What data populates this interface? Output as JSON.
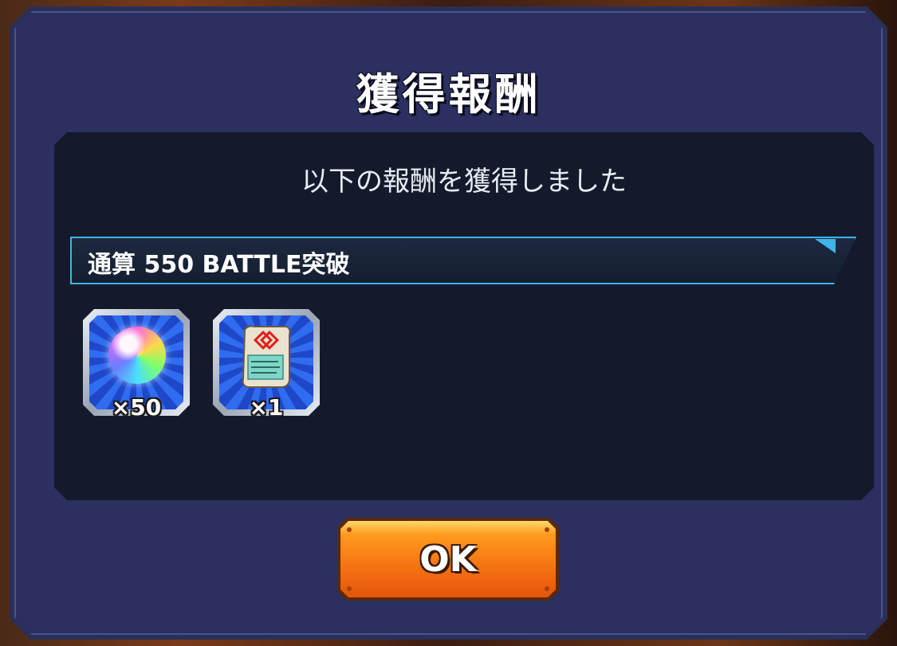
{
  "dialog": {
    "title": "獲得報酬",
    "message": "以下の報酬を獲得しました",
    "mission": "通算 550 BATTLE突破",
    "rewards": [
      {
        "icon": "rainbow-orb-icon",
        "quantity": "×50"
      },
      {
        "icon": "scroll-ticket-icon",
        "quantity": "×1"
      }
    ],
    "ok_label": "OK"
  },
  "colors": {
    "dialog_bg": "#2b3060",
    "panel_bg": "#141a2c",
    "mission_border": "#3fb4e6",
    "ok_button": "#f26a10"
  }
}
